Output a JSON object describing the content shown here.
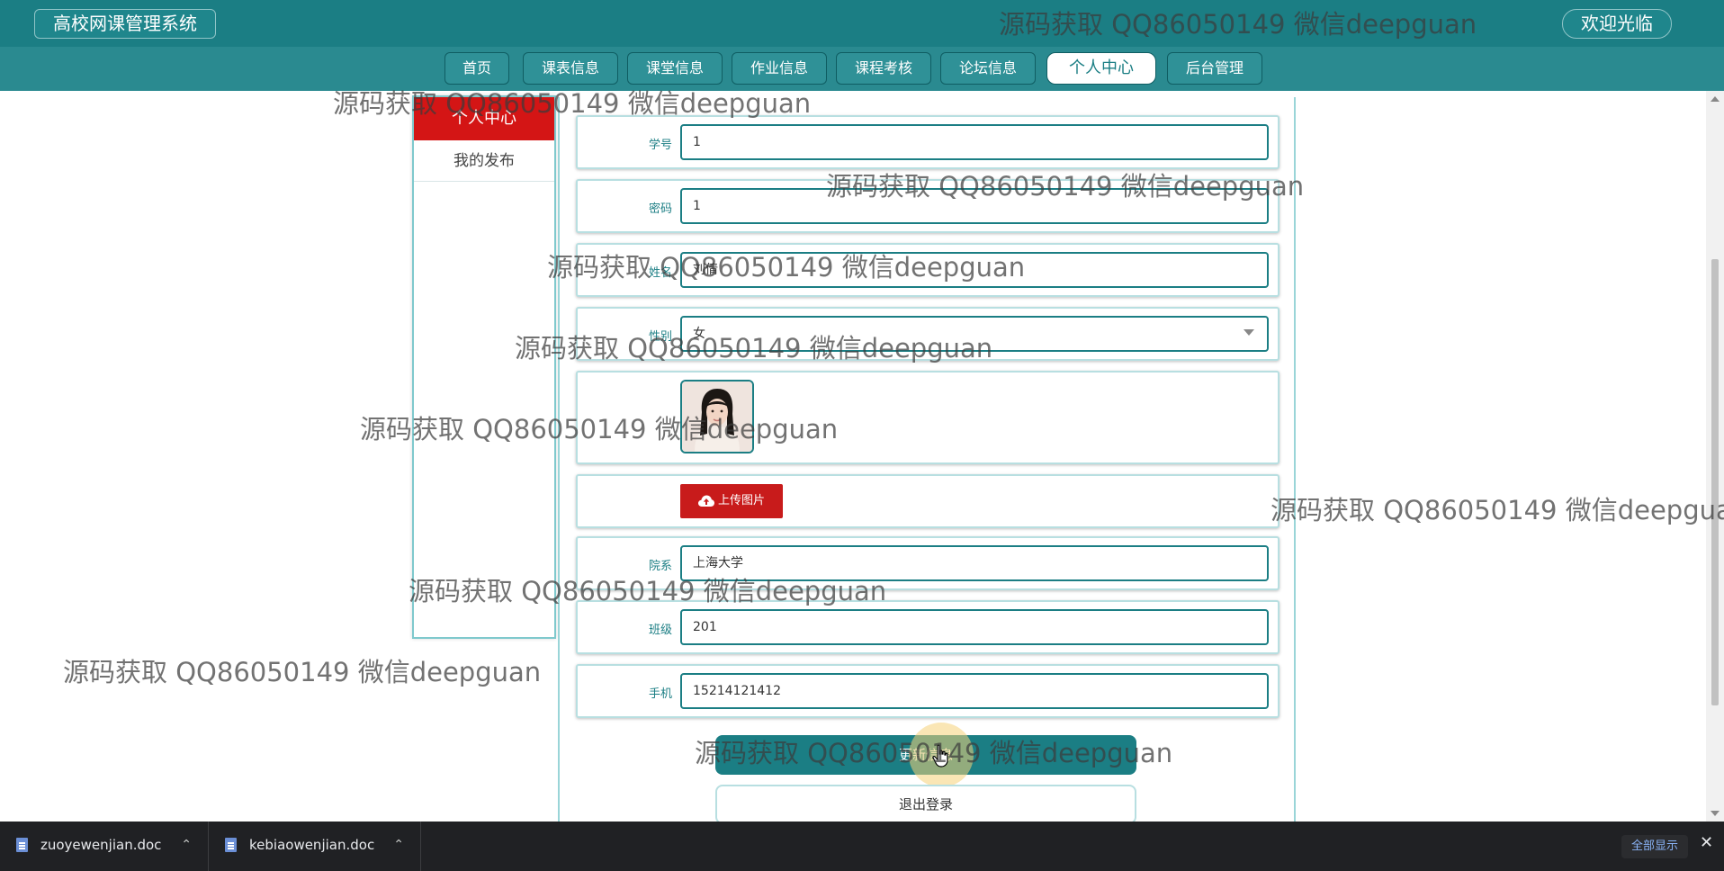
{
  "header": {
    "site_title": "高校网课管理系统",
    "welcome": "欢迎光临"
  },
  "nav": {
    "items": [
      "首页",
      "课表信息",
      "课堂信息",
      "作业信息",
      "课程考核",
      "论坛信息",
      "个人中心",
      "后台管理"
    ],
    "active": "个人中心"
  },
  "sidebar": {
    "header": "个人中心",
    "items": [
      "我的发布"
    ]
  },
  "form": {
    "student_id_label": "学号",
    "student_id_value": "1",
    "password_label": "密码",
    "password_value": "1",
    "name_label": "姓名",
    "name_value": "刘倩",
    "gender_label": "性别",
    "gender_value": "女",
    "upload_label": "上传图片",
    "department_label": "院系",
    "department_value": "上海大学",
    "class_label": "班级",
    "class_value": "201",
    "phone_label": "手机",
    "phone_value": "15214121412"
  },
  "actions": {
    "update": "更新信息",
    "logout": "退出登录"
  },
  "downloads": {
    "files": [
      "zuoyewenjian.doc",
      "kebiaowenjian.doc"
    ],
    "show_all": "全部显示"
  },
  "watermark": "源码获取 QQ86050149 微信deepguan",
  "colors": {
    "primary": "#1b7e84",
    "accent_red": "#d41515",
    "download_bar": "#202124"
  },
  "icons": {
    "upload": "cloud-upload-icon",
    "file": "doc-file-icon",
    "chevron": "chevron-up-icon",
    "close": "close-icon"
  }
}
